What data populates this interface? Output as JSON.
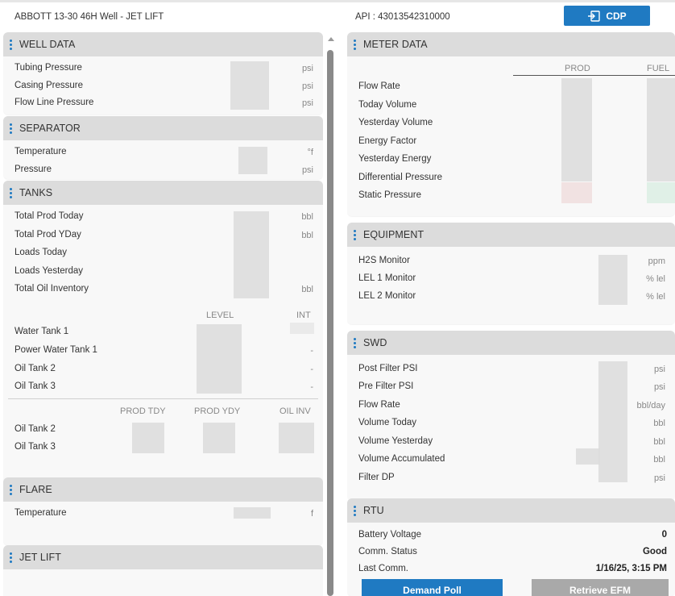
{
  "header": {
    "well_title": "ABBOTT 13-30 46H Well - JET LIFT",
    "api": "API : 43013542310000",
    "cdp_label": "CDP"
  },
  "well_data": {
    "title": "WELL DATA",
    "rows": [
      {
        "label": "Tubing Pressure",
        "unit": "psi"
      },
      {
        "label": "Casing Pressure",
        "unit": "psi"
      },
      {
        "label": "Flow Line Pressure",
        "unit": "psi"
      }
    ]
  },
  "separator": {
    "title": "SEPARATOR",
    "rows": [
      {
        "label": "Temperature",
        "unit": "°f"
      },
      {
        "label": "Pressure",
        "unit": "psi"
      }
    ]
  },
  "tanks": {
    "title": "TANKS",
    "rows": [
      {
        "label": "Total Prod Today",
        "unit": "bbl"
      },
      {
        "label": "Total Prod YDay",
        "unit": "bbl"
      },
      {
        "label": "Loads Today",
        "unit": ""
      },
      {
        "label": "Loads Yesterday",
        "unit": ""
      },
      {
        "label": "Total Oil Inventory",
        "unit": "bbl"
      }
    ],
    "level_header": "LEVEL",
    "int_header": "INT",
    "level_rows": [
      {
        "label": "Water Tank 1",
        "int": ""
      },
      {
        "label": "Power Water Tank 1",
        "int": "-"
      },
      {
        "label": "Oil Tank 2",
        "int": "-"
      },
      {
        "label": "Oil Tank 3",
        "int": "-"
      }
    ],
    "prod_headers": [
      "PROD TDY",
      "PROD YDY",
      "OIL INV"
    ],
    "prod_rows": [
      {
        "label": "Oil Tank 2"
      },
      {
        "label": "Oil Tank 3"
      }
    ]
  },
  "flare": {
    "title": "FLARE",
    "rows": [
      {
        "label": "Temperature",
        "unit": "f"
      }
    ]
  },
  "jet_lift": {
    "title": "JET LIFT"
  },
  "meter_data": {
    "title": "METER DATA",
    "col_prod": "PROD",
    "col_fuel": "FUEL",
    "rows": [
      {
        "label": "Flow Rate"
      },
      {
        "label": "Today Volume"
      },
      {
        "label": "Yesterday Volume"
      },
      {
        "label": "Energy Factor"
      },
      {
        "label": "Yesterday Energy"
      },
      {
        "label": "Differential Pressure"
      },
      {
        "label": "Static Pressure"
      }
    ]
  },
  "equipment": {
    "title": "EQUIPMENT",
    "rows": [
      {
        "label": "H2S Monitor",
        "unit": "ppm"
      },
      {
        "label": "LEL 1 Monitor",
        "unit": "% lel"
      },
      {
        "label": "LEL 2 Monitor",
        "unit": "% lel"
      }
    ]
  },
  "swd": {
    "title": "SWD",
    "rows": [
      {
        "label": "Post Filter PSI",
        "unit": "psi"
      },
      {
        "label": "Pre Filter PSI",
        "unit": "psi"
      },
      {
        "label": "Flow Rate",
        "unit": "bbl/day"
      },
      {
        "label": "Volume Today",
        "unit": "bbl"
      },
      {
        "label": "Volume Yesterday",
        "unit": "bbl"
      },
      {
        "label": "Volume Accumulated",
        "unit": "bbl"
      },
      {
        "label": "Filter DP",
        "unit": "psi"
      }
    ]
  },
  "rtu": {
    "title": "RTU",
    "rows": [
      {
        "label": "Battery Voltage",
        "value": "0"
      },
      {
        "label": "Comm. Status",
        "value": "Good"
      },
      {
        "label": "Last Comm.",
        "value": "1/16/25, 3:15 PM"
      }
    ],
    "demand_poll_label": "Demand Poll",
    "retrieve_efm_label": "Retrieve EFM"
  },
  "colors": {
    "accent": "#1f7ac2",
    "header_bg": "#dcdcdc",
    "card_bg": "#f8f8f8",
    "disabled_btn": "#a9a9a9"
  }
}
